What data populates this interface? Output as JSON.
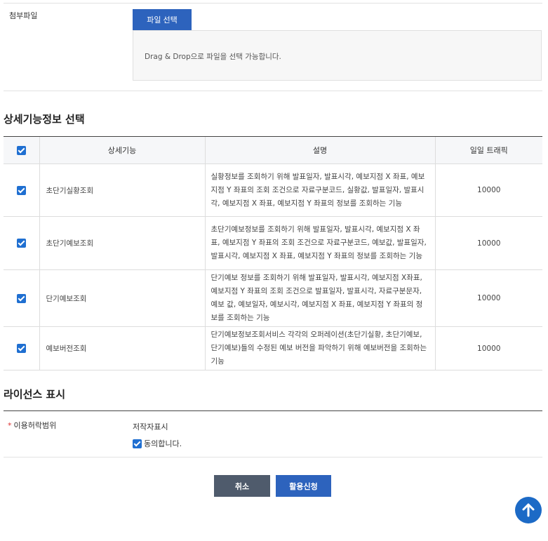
{
  "attachment": {
    "label": "첨부파일",
    "select_button": "파일 선택",
    "drop_hint": "Drag & Drop으로 파일을 선택 가능합니다."
  },
  "detail_section": {
    "title": "상세기능정보 선택",
    "headers": {
      "name": "상세기능",
      "desc": "설명",
      "traffic": "일일 트래픽"
    },
    "rows": [
      {
        "name": "초단기실황조회",
        "desc": "실황정보를 조회하기 위해 발표일자, 발표시각, 예보지점 X 좌표, 예보지점 Y 좌표의 조회 조건으로 자료구분코드, 실황값, 발표일자, 발표시각, 예보지점 X 좌표, 예보지점 Y 좌표의 정보를 조회하는 기능",
        "traffic": "10000"
      },
      {
        "name": "초단기예보조회",
        "desc": "초단기예보정보를 조회하기 위해 발표일자, 발표시각, 예보지점 X 좌표, 예보지점 Y 좌표의 조회 조건으로 자료구분코드, 예보값, 발표일자, 발표시각, 예보지점 X 좌표, 예보지점 Y 좌표의 정보를 조회하는 기능",
        "traffic": "10000"
      },
      {
        "name": "단기예보조회",
        "desc": "단기예보 정보를 조회하기 위해 발표일자, 발표시각, 예보지점 X좌표, 예보지점 Y 좌표의 조회 조건으로 발표일자, 발표시각, 자료구분문자, 예보 값, 예보일자, 예보시각, 예보지점 X 좌표, 예보지점 Y 좌표의 정보를 조회하는 기능",
        "traffic": "10000"
      },
      {
        "name": "예보버전조회",
        "desc": "단기예보정보조회서비스 각각의 오퍼레이션(초단기실황, 초단기예보, 단기예보)들의 수정된 예보 버전을 파악하기 위해 예보버전을 조회하는 기능",
        "traffic": "10000"
      }
    ]
  },
  "license": {
    "title": "라이선스 표시",
    "required_mark": "*",
    "label": "이용허락범위",
    "text": "저작자표시",
    "agree_label": "동의합니다."
  },
  "buttons": {
    "cancel": "취소",
    "apply": "활용신청"
  },
  "colors": {
    "primary": "#2d63bd",
    "cancel": "#4f5b6c",
    "checkbox": "#1f6fd1",
    "scroll_top": "#1c6ac6"
  },
  "icons": {
    "scroll_top": "arrow-up-icon",
    "checkbox": "checkbox-checked-icon"
  }
}
